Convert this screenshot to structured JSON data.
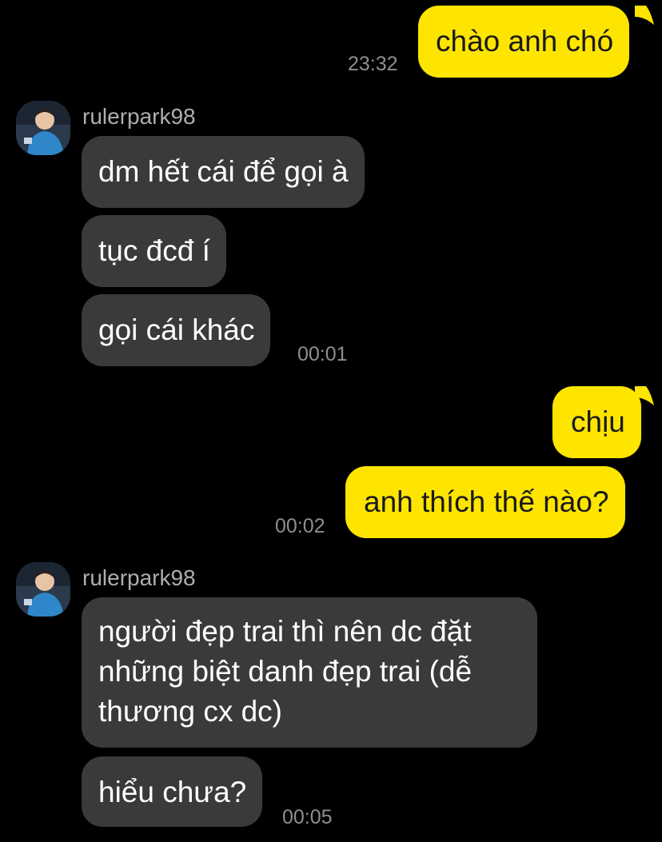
{
  "colors": {
    "background": "#000000",
    "outgoing_bubble": "#FEE500",
    "incoming_bubble": "#3A3A3C",
    "timestamp": "#8E8E93"
  },
  "messages": [
    {
      "direction": "outgoing",
      "text": "chào anh chó",
      "time": "23:32"
    },
    {
      "direction": "incoming",
      "sender": "rulerpark98",
      "text": "dm hết cái để gọi à"
    },
    {
      "direction": "incoming",
      "text": "tục đcđ í"
    },
    {
      "direction": "incoming",
      "text": "gọi cái khác",
      "time": "00:01"
    },
    {
      "direction": "outgoing",
      "text": "chịu"
    },
    {
      "direction": "outgoing",
      "text": "anh thích thế nào?",
      "time": "00:02"
    },
    {
      "direction": "incoming",
      "sender": "rulerpark98",
      "text": "người đẹp trai thì nên dc đặt những biệt danh đẹp trai (dễ thương cx dc)"
    },
    {
      "direction": "incoming",
      "text": "hiểu chưa?",
      "time": "00:05"
    }
  ],
  "avatar_icon": "profile-photo-child"
}
